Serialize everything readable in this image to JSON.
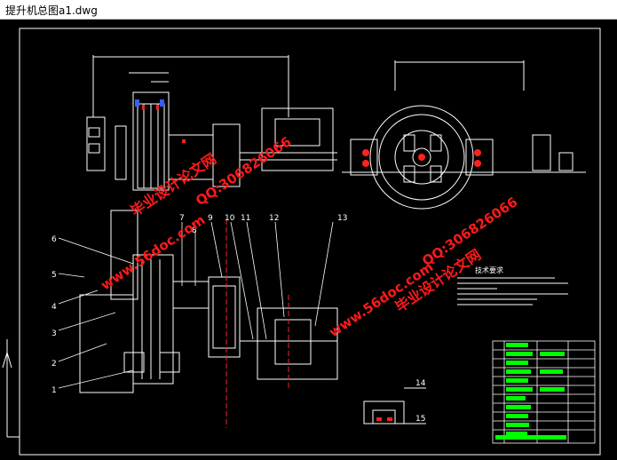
{
  "window": {
    "title": "提升机总图a1.dwg"
  },
  "drawing": {
    "part_numbers": [
      "1",
      "2",
      "3",
      "4",
      "5",
      "6",
      "7",
      "8",
      "9",
      "10",
      "11",
      "12",
      "13",
      "14",
      "15"
    ],
    "watermarks": [
      "毕业设计论文网",
      "www.56doc.com",
      "QQ:306826066",
      "www.56doc.com",
      "QQ:306826066",
      "毕业设计论文网"
    ],
    "tech_requirements_title": "技术要求"
  },
  "colors": {
    "canvas": "#000000",
    "lines": "#ffffff",
    "red": "#ff2020",
    "green": "#00ff00",
    "yellow": "#ffff00",
    "cyan": "#00ffff",
    "magenta": "#ff00ff"
  },
  "icons": [
    "ucs-icon"
  ]
}
